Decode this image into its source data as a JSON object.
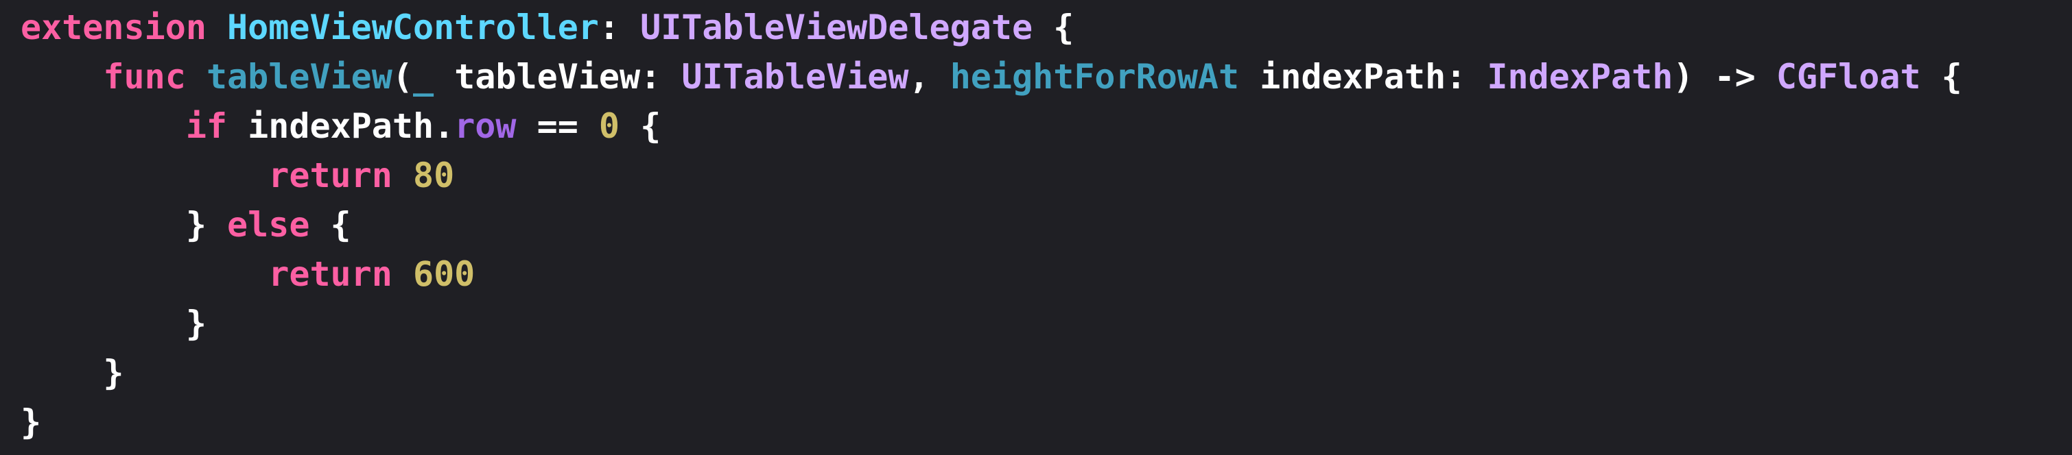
{
  "editor": {
    "theme": {
      "background": "#1f1f24",
      "plain": "#ffffff",
      "keyword": "#fc5fa3",
      "type_decl": "#5dd8ff",
      "type_other": "#d0a8ff",
      "func_decl": "#67b7a4",
      "other_decl": "#41a1c0",
      "property": "#a167e6",
      "number": "#d0bf69"
    },
    "lines": [
      {
        "tokens": [
          {
            "t": "extension",
            "k": "keyword"
          },
          {
            "t": " ",
            "k": "plain"
          },
          {
            "t": "HomeViewController",
            "k": "type"
          },
          {
            "t": ": ",
            "k": "plain"
          },
          {
            "t": "UITableViewDelegate",
            "k": "type-other"
          },
          {
            "t": " {",
            "k": "plain"
          }
        ]
      },
      {
        "tokens": [
          {
            "t": "    ",
            "k": "plain"
          },
          {
            "t": "func",
            "k": "keyword"
          },
          {
            "t": " ",
            "k": "plain"
          },
          {
            "t": "tableView",
            "k": "other-decl"
          },
          {
            "t": "(",
            "k": "plain"
          },
          {
            "t": "_",
            "k": "other-decl"
          },
          {
            "t": " tableView: ",
            "k": "plain"
          },
          {
            "t": "UITableView",
            "k": "type-other"
          },
          {
            "t": ", ",
            "k": "plain"
          },
          {
            "t": "heightForRowAt",
            "k": "other-decl"
          },
          {
            "t": " indexPath: ",
            "k": "plain"
          },
          {
            "t": "IndexPath",
            "k": "type-other"
          },
          {
            "t": ") -> ",
            "k": "plain"
          },
          {
            "t": "CGFloat",
            "k": "type-other"
          },
          {
            "t": " {",
            "k": "plain"
          }
        ]
      },
      {
        "tokens": [
          {
            "t": "        ",
            "k": "plain"
          },
          {
            "t": "if",
            "k": "keyword"
          },
          {
            "t": " indexPath.",
            "k": "plain"
          },
          {
            "t": "row",
            "k": "prop"
          },
          {
            "t": " == ",
            "k": "plain"
          },
          {
            "t": "0",
            "k": "number"
          },
          {
            "t": " {",
            "k": "plain"
          }
        ]
      },
      {
        "tokens": [
          {
            "t": "            ",
            "k": "plain"
          },
          {
            "t": "return",
            "k": "keyword"
          },
          {
            "t": " ",
            "k": "plain"
          },
          {
            "t": "80",
            "k": "number"
          }
        ]
      },
      {
        "tokens": [
          {
            "t": "        } ",
            "k": "plain"
          },
          {
            "t": "else",
            "k": "keyword"
          },
          {
            "t": " {",
            "k": "plain"
          }
        ]
      },
      {
        "tokens": [
          {
            "t": "            ",
            "k": "plain"
          },
          {
            "t": "return",
            "k": "keyword"
          },
          {
            "t": " ",
            "k": "plain"
          },
          {
            "t": "600",
            "k": "number"
          }
        ]
      },
      {
        "tokens": [
          {
            "t": "        }",
            "k": "plain"
          }
        ]
      },
      {
        "tokens": [
          {
            "t": "    }",
            "k": "plain"
          }
        ]
      },
      {
        "tokens": [
          {
            "t": "}",
            "k": "plain"
          }
        ]
      }
    ]
  }
}
